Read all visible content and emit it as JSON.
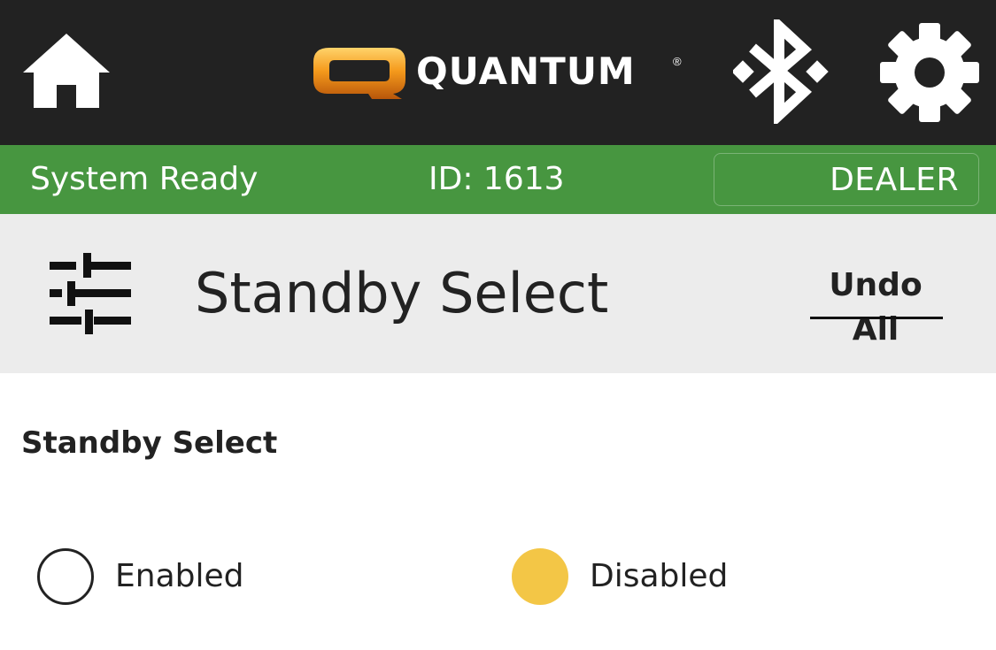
{
  "header": {
    "logo_text": "QUANTUM",
    "logo_mark": "Q",
    "logo_registered": "®",
    "icons": {
      "home": "home-icon",
      "bluetooth": "bluetooth-icon",
      "settings": "gear-icon"
    }
  },
  "status": {
    "text": "System Ready",
    "id": "ID: 1613",
    "dealer_label": "DEALER",
    "color": "#479640"
  },
  "section": {
    "icon": "sliders-icon",
    "title": "Standby Select",
    "undo_label": "Undo All"
  },
  "setting": {
    "label": "Standby Select",
    "options": [
      {
        "label": "Enabled",
        "selected": false
      },
      {
        "label": "Disabled",
        "selected": true
      }
    ],
    "selected_color": "#f3c646"
  }
}
